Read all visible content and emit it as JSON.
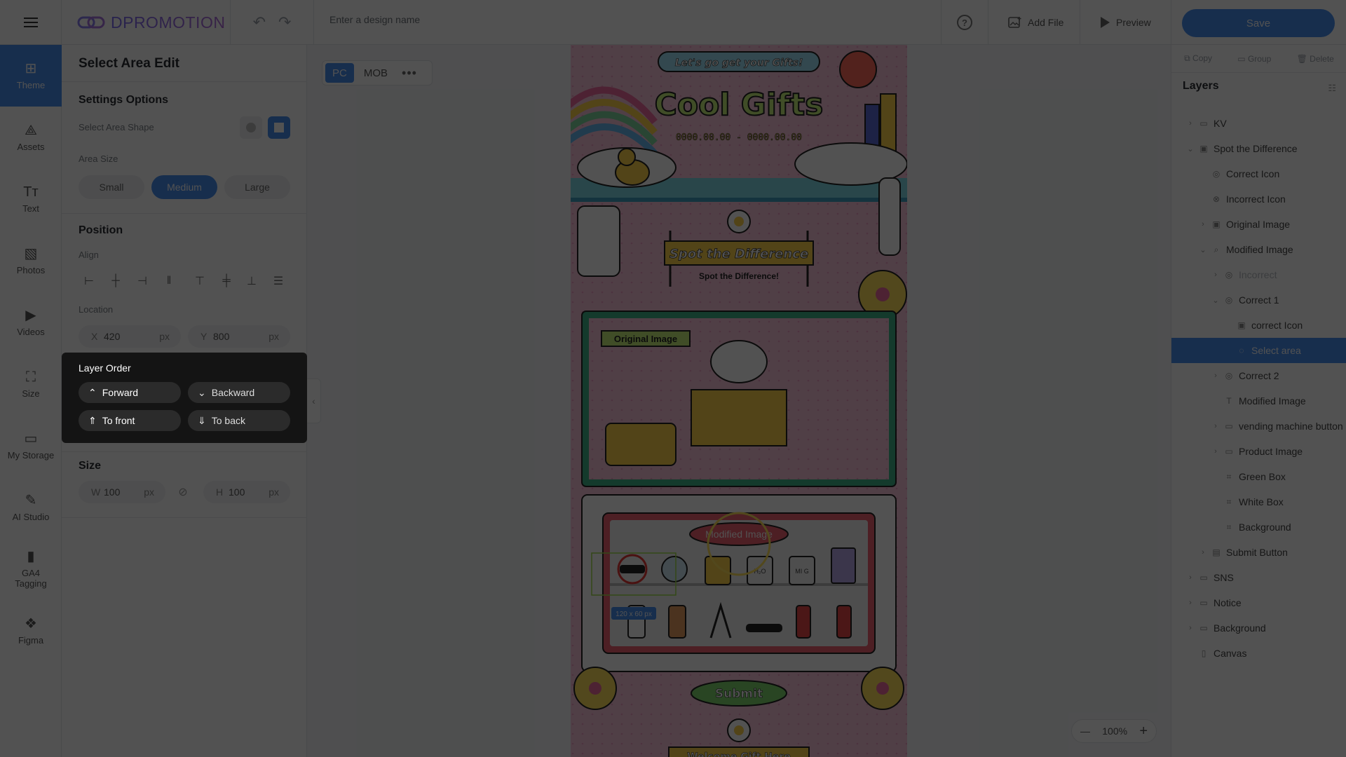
{
  "header": {
    "logo_text": "DPROMOTION",
    "design_name_placeholder": "Enter a design name",
    "add_file": "Add File",
    "preview": "Preview",
    "save": "Save"
  },
  "rail": {
    "items": [
      {
        "label": "Theme",
        "icon": "theme-icon",
        "active": true
      },
      {
        "label": "Assets",
        "icon": "assets-icon"
      },
      {
        "label": "Text",
        "icon": "text-icon"
      },
      {
        "label": "Photos",
        "icon": "photos-icon"
      },
      {
        "label": "Videos",
        "icon": "videos-icon"
      },
      {
        "label": "Size",
        "icon": "size-icon"
      },
      {
        "label": "My Storage",
        "icon": "folder-icon"
      },
      {
        "label": "AI Studio",
        "icon": "magic-wand-icon"
      },
      {
        "label": "GA4 Tagging",
        "icon": "chart-icon"
      },
      {
        "label": "Figma",
        "icon": "figma-icon"
      }
    ]
  },
  "panel": {
    "title": "Select Area Edit",
    "settings_title": "Settings Options",
    "shape_label": "Select Area Shape",
    "area_size_label": "Area Size",
    "sizes": [
      "Small",
      "Medium",
      "Large"
    ],
    "selected_size": "Medium",
    "position_title": "Position",
    "align_label": "Align",
    "location_label": "Location",
    "x_key": "X",
    "x_value": "420",
    "y_key": "Y",
    "y_value": "800",
    "unit": "px",
    "layer_order_title": "Layer Order",
    "forward": "Forward",
    "backward": "Backward",
    "to_front": "To front",
    "to_back": "To back",
    "size_title": "Size",
    "w_key": "W",
    "w_value": "100",
    "h_key": "H",
    "h_value": "100"
  },
  "canvas": {
    "device_tabs": [
      "PC",
      "MOB"
    ],
    "selected_tab": "PC",
    "headline_top": "Let's go get your Gifts!",
    "title": "Cool Gifts",
    "date_range": "0000.00.00 - 0000.00.00",
    "banner": "Spot the Difference",
    "banner_sub": "Spot the Difference!",
    "original_label": "Original Image",
    "modified_label": "Modified Image",
    "size_badge": "120 x 60 px",
    "submit": "Submit",
    "bottom_banner": "Welcome Gift Here",
    "mug_labels": [
      "H₂O",
      "MI G"
    ]
  },
  "rpanel": {
    "copy": "Copy",
    "group": "Group",
    "delete": "Delete",
    "layers_title": "Layers",
    "layers": [
      {
        "label": "KV",
        "chev": "›",
        "icon": "folder",
        "indent": 0
      },
      {
        "label": "Spot the Difference",
        "chev": "⌄",
        "icon": "image",
        "indent": 0
      },
      {
        "label": "Correct Icon",
        "chev": "",
        "icon": "target",
        "indent": 1
      },
      {
        "label": "Incorrect Icon",
        "chev": "",
        "icon": "x-circle",
        "indent": 1
      },
      {
        "label": "Original Image",
        "chev": "›",
        "icon": "image",
        "indent": 1
      },
      {
        "label": "Modified Image",
        "chev": "⌄",
        "icon": "search",
        "indent": 1
      },
      {
        "label": "Incorrect",
        "chev": "›",
        "icon": "target",
        "indent": 2,
        "faded": true
      },
      {
        "label": "Correct 1",
        "chev": "⌄",
        "icon": "target",
        "indent": 2
      },
      {
        "label": "correct Icon",
        "chev": "",
        "icon": "image",
        "indent": 3
      },
      {
        "label": "Select area",
        "chev": "",
        "icon": "dashed-circle",
        "indent": 3,
        "selected": true
      },
      {
        "label": "Correct 2",
        "chev": "›",
        "icon": "target",
        "indent": 2
      },
      {
        "label": "Modified Image",
        "chev": "",
        "icon": "text",
        "indent": 2
      },
      {
        "label": "vending machine button",
        "chev": "›",
        "icon": "folder",
        "indent": 2
      },
      {
        "label": "Product Image",
        "chev": "›",
        "icon": "folder",
        "indent": 2
      },
      {
        "label": "Green Box",
        "chev": "",
        "icon": "frame",
        "indent": 2
      },
      {
        "label": "White Box",
        "chev": "",
        "icon": "frame",
        "indent": 2
      },
      {
        "label": "Background",
        "chev": "",
        "icon": "frame",
        "indent": 2
      },
      {
        "label": "Submit Button",
        "chev": "›",
        "icon": "button",
        "indent": 1
      },
      {
        "label": "SNS",
        "chev": "›",
        "icon": "folder",
        "indent": 0
      },
      {
        "label": "Notice",
        "chev": "›",
        "icon": "folder",
        "indent": 0
      },
      {
        "label": "Background",
        "chev": "›",
        "icon": "folder",
        "indent": 0
      },
      {
        "label": "Canvas",
        "chev": "",
        "icon": "page",
        "indent": 0
      }
    ]
  },
  "zoom": {
    "value": "100%"
  },
  "colors": {
    "accent": "#4a8ff0",
    "canvas_bg": "#f6c0d8",
    "panel_dark": "#141414"
  }
}
